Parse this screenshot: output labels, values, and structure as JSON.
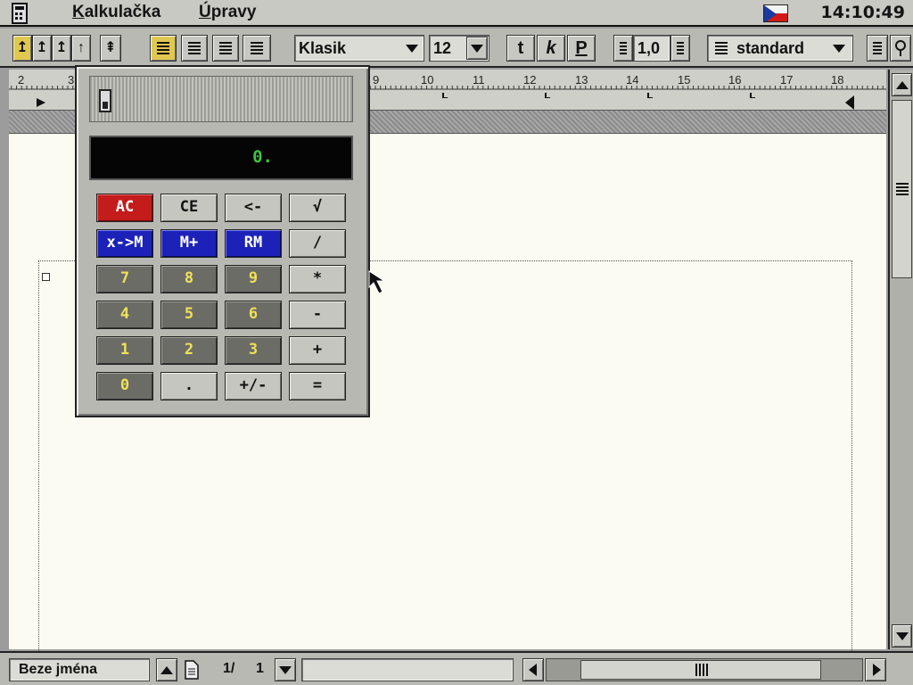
{
  "menubar": {
    "app_icon": "calculator-icon",
    "items": [
      {
        "pre": "",
        "ul": "K",
        "post": "alkulačka"
      },
      {
        "pre": "",
        "ul": "Ú",
        "post": "pravy"
      }
    ],
    "clock": "14:10:49",
    "flag": "czech-flag-icon"
  },
  "toolbar": {
    "font_name": "Klasik",
    "font_size": "12",
    "style_bold": "t",
    "style_italic": "k",
    "style_underline": "P",
    "line_spacing": "1,0",
    "paragraph_style": "standard",
    "accent_color": "#e0c850"
  },
  "ruler": {
    "labels": [
      "2",
      "3",
      "9",
      "10",
      "11",
      "12",
      "13",
      "14",
      "15",
      "16",
      "17",
      "18"
    ]
  },
  "calculator": {
    "display_value": "0.",
    "buttons": [
      {
        "label": "AC",
        "style": "red",
        "name": "all-clear-button"
      },
      {
        "label": "CE",
        "style": "light",
        "name": "clear-entry-button"
      },
      {
        "label": "<-",
        "style": "light",
        "name": "backspace-button"
      },
      {
        "label": "√",
        "style": "light",
        "name": "sqrt-button"
      },
      {
        "label": "x->M",
        "style": "blue",
        "name": "memory-store-button"
      },
      {
        "label": "M+",
        "style": "blue",
        "name": "memory-add-button"
      },
      {
        "label": "RM",
        "style": "blue",
        "name": "memory-recall-button"
      },
      {
        "label": "/",
        "style": "light",
        "name": "divide-button"
      },
      {
        "label": "7",
        "style": "dark",
        "name": "digit-7-button"
      },
      {
        "label": "8",
        "style": "dark",
        "name": "digit-8-button"
      },
      {
        "label": "9",
        "style": "dark",
        "name": "digit-9-button"
      },
      {
        "label": "*",
        "style": "light",
        "name": "multiply-button"
      },
      {
        "label": "4",
        "style": "dark",
        "name": "digit-4-button"
      },
      {
        "label": "5",
        "style": "dark",
        "name": "digit-5-button"
      },
      {
        "label": "6",
        "style": "dark",
        "name": "digit-6-button"
      },
      {
        "label": "-",
        "style": "light",
        "name": "subtract-button"
      },
      {
        "label": "1",
        "style": "dark",
        "name": "digit-1-button"
      },
      {
        "label": "2",
        "style": "dark",
        "name": "digit-2-button"
      },
      {
        "label": "3",
        "style": "dark",
        "name": "digit-3-button"
      },
      {
        "label": "+",
        "style": "light",
        "name": "add-button"
      },
      {
        "label": "0",
        "style": "dark",
        "name": "digit-0-button"
      },
      {
        "label": ".",
        "style": "light",
        "name": "decimal-button"
      },
      {
        "label": "+/-",
        "style": "light",
        "name": "sign-toggle-button"
      },
      {
        "label": "=",
        "style": "light",
        "name": "equals-button"
      }
    ]
  },
  "statusbar": {
    "document_name": "Beze jména",
    "page_current": "1/",
    "page_total": "1"
  }
}
